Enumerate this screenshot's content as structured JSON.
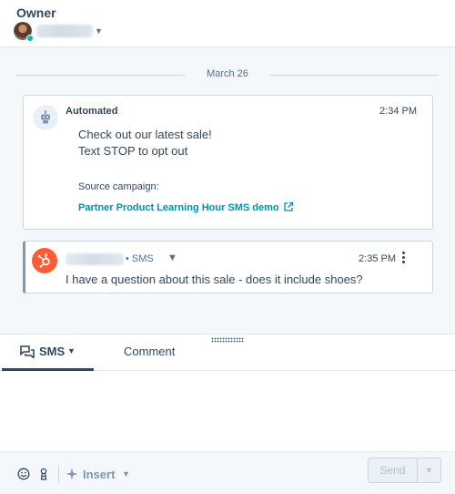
{
  "owner": {
    "label": "Owner",
    "avatar_icon": "user-avatar",
    "presence_color": "#00bda5",
    "name_redacted": true
  },
  "timeline": {
    "date_divider": "March 26",
    "automated": {
      "sender": "Automated",
      "time": "2:34 PM",
      "message_lines": [
        "Check out our latest sale!",
        "Text STOP to opt out"
      ],
      "source_label": "Source campaign:",
      "campaign_link": "Partner Product Learning Hour SMS demo",
      "icon": "robot-icon",
      "link_icon": "external-link-icon"
    },
    "sms": {
      "sender_redacted": true,
      "channel": "• SMS",
      "time": "2:35 PM",
      "message": "I have a question about this sale - does it include shoes?",
      "icon": "hubspot-logo-icon",
      "accent_color": "#ff5c35"
    }
  },
  "composer": {
    "tabs": [
      {
        "label": "SMS",
        "active": true
      },
      {
        "label": "Comment",
        "active": false
      }
    ],
    "toolbar": {
      "insert_label": "Insert",
      "send_label": "Send"
    }
  },
  "colors": {
    "link": "#0091ae",
    "text": "#33475b",
    "background": "#f5f8fa"
  }
}
